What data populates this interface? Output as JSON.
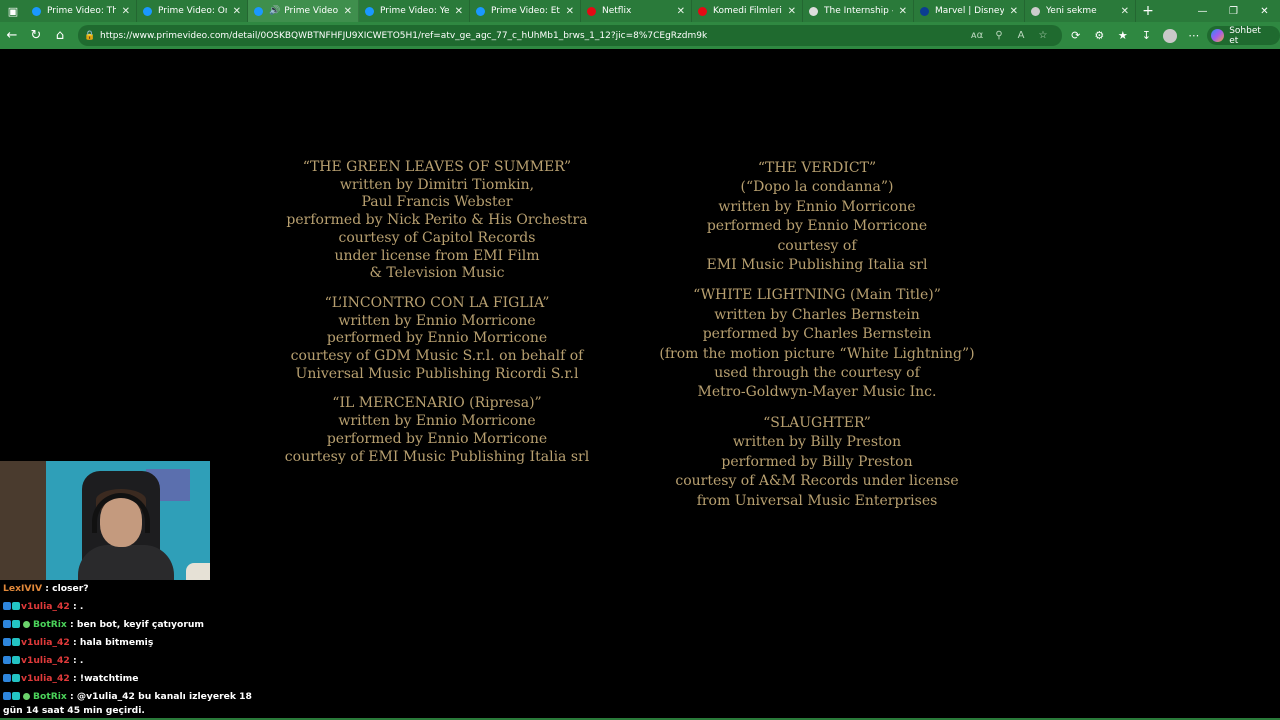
{
  "browser": {
    "tabs": [
      {
        "title": "Prime Video: The M",
        "favicon_color": "#1a98ff",
        "active": false
      },
      {
        "title": "Prime Video: Once",
        "favicon_color": "#1a98ff",
        "active": false
      },
      {
        "title": "Prime Video: C",
        "favicon_color": "#1a98ff",
        "active": true,
        "audio": true
      },
      {
        "title": "Prime Video: Yes M",
        "favicon_color": "#1a98ff",
        "active": false
      },
      {
        "title": "Prime Video: Etern",
        "favicon_color": "#1a98ff",
        "active": false
      },
      {
        "title": "Netflix",
        "favicon_color": "#e50914",
        "active": false
      },
      {
        "title": "Komedi Filmleri - N",
        "favicon_color": "#e50914",
        "active": false
      },
      {
        "title": "The Internship - Go",
        "favicon_color": "#dddddd",
        "active": false
      },
      {
        "title": "Marvel | Disney+",
        "favicon_color": "#0b3d91",
        "active": false
      },
      {
        "title": "Yeni sekme",
        "favicon_color": "#cccccc",
        "active": false
      }
    ],
    "url": "https://www.primevideo.com/detail/0OSKBQWBTNFHFJU9XICWETO5H1/ref=atv_ge_agc_77_c_hUhMb1_brws_1_12?jic=8%7CEgRzdm9k",
    "copilot_label": "Sohbet et",
    "accent_color": "#2f8841"
  },
  "credits": {
    "left": [
      {
        "lines": [
          "“THE GREEN LEAVES OF SUMMER”",
          "written by Dimitri Tiomkin,",
          "Paul Francis Webster",
          "performed by Nick Perito & His Orchestra",
          "courtesy of Capitol Records",
          "under license from EMI Film",
          "& Television Music"
        ]
      },
      {
        "lines": [
          "“L’INCONTRO CON LA FIGLIA”",
          "written by Ennio Morricone",
          "performed by Ennio Morricone",
          "courtesy of  GDM Music S.r.l. on behalf of",
          "Universal Music Publishing Ricordi S.r.l"
        ]
      },
      {
        "lines": [
          "“IL MERCENARIO (Ripresa)”",
          "written by Ennio Morricone",
          "performed by Ennio Morricone",
          "courtesy of  EMI Music Publishing Italia srl"
        ]
      }
    ],
    "right": [
      {
        "lines": [
          "“THE VERDICT”",
          "(“Dopo la condanna”)",
          "written by Ennio Morricone",
          "performed by Ennio Morricone",
          "courtesy of",
          "EMI Music Publishing Italia srl"
        ]
      },
      {
        "lines": [
          "“WHITE LIGHTNING (Main Title)”",
          "written by Charles Bernstein",
          "performed by Charles Bernstein",
          "(from the motion picture “White Lightning”)",
          "used through the courtesy of",
          "Metro-Goldwyn-Mayer Music Inc."
        ]
      },
      {
        "lines": [
          "“SLAUGHTER”",
          "written by Billy Preston",
          "performed by Billy Preston",
          "courtesy of  A&M Records under license",
          "from Universal Music Enterprises"
        ]
      }
    ],
    "text_color": "#b8a070"
  },
  "chat": [
    {
      "user": "LexIVIV",
      "user_class": "user-lexi",
      "badges": [],
      "text": ": closer?"
    },
    {
      "user": "v1ulia_42",
      "user_class": "user-v1",
      "badges": [
        "b1",
        "b2"
      ],
      "text": ": ."
    },
    {
      "user": "BotRix",
      "user_class": "user-bot",
      "badges": [
        "b1",
        "b2",
        "bot"
      ],
      "text": ": ben bot, keyif çatıyorum"
    },
    {
      "user": "v1ulia_42",
      "user_class": "user-v1",
      "badges": [
        "b1",
        "b2"
      ],
      "text": ": hala bitmemiş"
    },
    {
      "user": "v1ulia_42",
      "user_class": "user-v1",
      "badges": [
        "b1",
        "b2"
      ],
      "text": ": ."
    },
    {
      "user": "v1ulia_42",
      "user_class": "user-v1",
      "badges": [
        "b1",
        "b2"
      ],
      "text": ": !watchtime"
    },
    {
      "user": "BotRix",
      "user_class": "user-bot",
      "badges": [
        "b1",
        "b2",
        "bot"
      ],
      "text": ": @v1ulia_42 bu kanalı izleyerek 18 gün 14 saat 45 min geçirdi.",
      "wrap": true
    }
  ]
}
